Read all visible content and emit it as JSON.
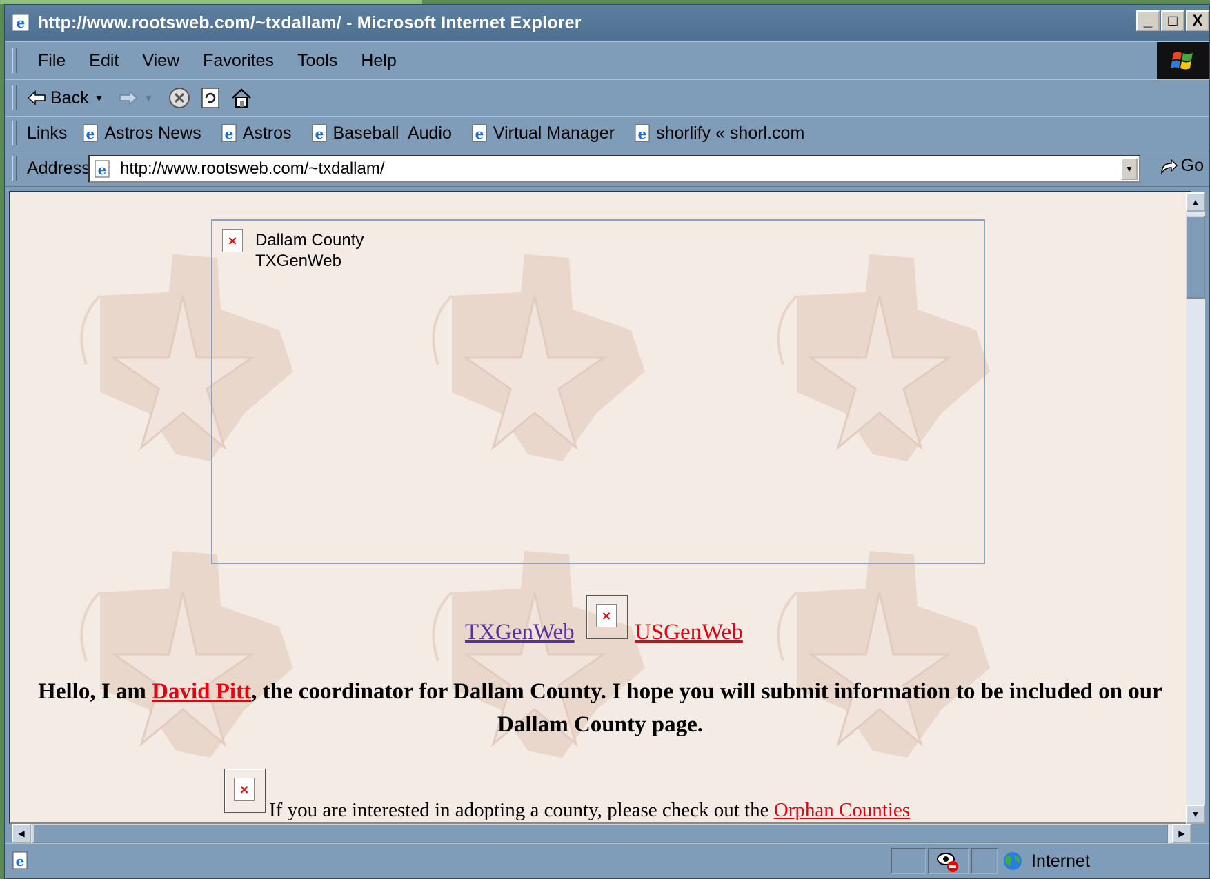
{
  "window": {
    "title": "http://www.rootsweb.com/~txdallam/ - Microsoft Internet Explorer",
    "controls": {
      "minimize": "_",
      "maximize": "□",
      "close": "X"
    }
  },
  "menu": [
    "File",
    "Edit",
    "View",
    "Favorites",
    "Tools",
    "Help"
  ],
  "toolbar": {
    "back_label": "Back"
  },
  "links": {
    "label": "Links",
    "items": [
      "Astros News",
      "Astros",
      "Baseball  Audio",
      "Virtual Manager",
      "shorlify « shorl.com"
    ]
  },
  "address": {
    "label": "Address",
    "url": "http://www.rootsweb.com/~txdallam/",
    "go_label": "Go"
  },
  "page": {
    "banner_alt_line1": "Dallam County",
    "banner_alt_line2": "TXGenWeb",
    "broken_mark": "×",
    "txgenweb_link": "TXGenWeb",
    "usgenweb_link": "USGenWeb",
    "hello_prefix": "Hello, I am ",
    "coordinator_name": "David Pitt",
    "hello_suffix": ", the coordinator for Dallam County. I hope you will submit information to be included on our Dallam County page.",
    "orphan_text": "If you are interested in adopting a county, please check out the ",
    "orphan_link": "Orphan Counties",
    "colors": {
      "visited_link": "#5a2fa0",
      "link": "#e8000f",
      "background": "#f4ebe5"
    }
  },
  "status": {
    "zone": "Internet"
  },
  "icons": [
    "ie-page-icon",
    "back-arrow-icon",
    "forward-arrow-icon",
    "stop-icon",
    "refresh-icon",
    "home-icon",
    "go-arrow-icon",
    "globe-icon",
    "privacy-icon",
    "windows-flag-icon"
  ]
}
